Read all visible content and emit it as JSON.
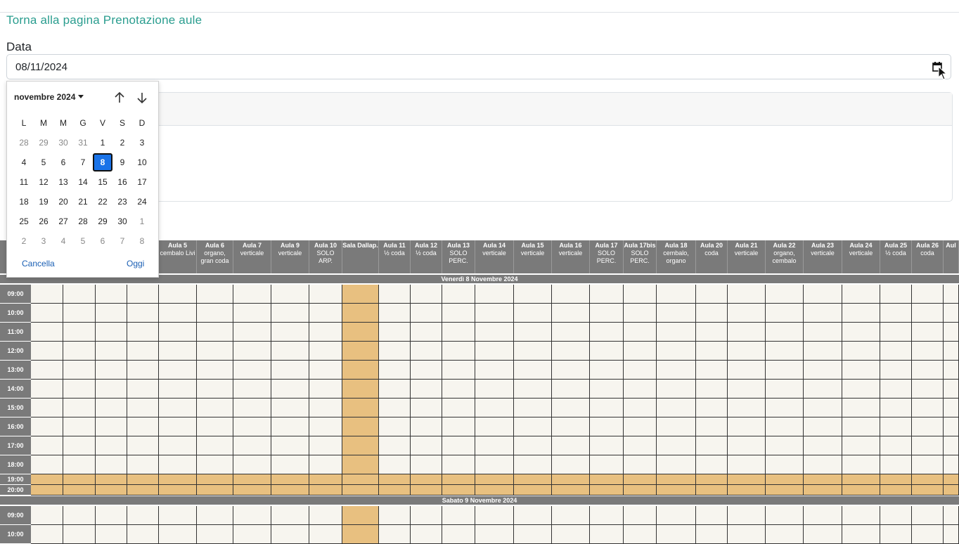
{
  "page": {
    "back_link": "Torna alla pagina Prenotazione aule",
    "date_label": "Data",
    "date_value": "08/11/2024"
  },
  "picker": {
    "month_label": "novembre 2024",
    "weekdays": [
      "L",
      "M",
      "M",
      "G",
      "V",
      "S",
      "D"
    ],
    "weeks": [
      [
        "28",
        "29",
        "30",
        "31",
        "1",
        "2",
        "3"
      ],
      [
        "4",
        "5",
        "6",
        "7",
        "8",
        "9",
        "10"
      ],
      [
        "11",
        "12",
        "13",
        "14",
        "15",
        "16",
        "17"
      ],
      [
        "18",
        "19",
        "20",
        "21",
        "22",
        "23",
        "24"
      ],
      [
        "25",
        "26",
        "27",
        "28",
        "29",
        "30",
        "1"
      ],
      [
        "2",
        "3",
        "4",
        "5",
        "6",
        "7",
        "8"
      ]
    ],
    "selected_day": "8",
    "cancel_label": "Cancella",
    "today_label": "Oggi"
  },
  "rooms": [
    {
      "name": "Aula 5",
      "desc": "cembalo Livi"
    },
    {
      "name": "Aula 6",
      "desc": "organo, gran coda"
    },
    {
      "name": "Aula 7",
      "desc": "verticale"
    },
    {
      "name": "Aula 9",
      "desc": "verticale"
    },
    {
      "name": "Aula 10",
      "desc": "SOLO ARP."
    },
    {
      "name": "Sala Dallap.",
      "desc": ""
    },
    {
      "name": "Aula 11",
      "desc": "½ coda"
    },
    {
      "name": "Aula 12",
      "desc": "½ coda"
    },
    {
      "name": "Aula 13",
      "desc": "SOLO PERC."
    },
    {
      "name": "Aula 14",
      "desc": "verticale"
    },
    {
      "name": "Aula 15",
      "desc": "verticale"
    },
    {
      "name": "Aula 16",
      "desc": "verticale"
    },
    {
      "name": "Aula 17",
      "desc": "SOLO PERC."
    },
    {
      "name": "Aula 17bis",
      "desc": "SOLO PERC."
    },
    {
      "name": "Aula 18",
      "desc": "cembalo, organo"
    },
    {
      "name": "Aula 20",
      "desc": "coda"
    },
    {
      "name": "Aula 21",
      "desc": "verticale"
    },
    {
      "name": "Aula 22",
      "desc": "organo, cembalo"
    },
    {
      "name": "Aula 23",
      "desc": "verticale"
    },
    {
      "name": "Aula 24",
      "desc": "verticale"
    },
    {
      "name": "Aula 25",
      "desc": "½ coda"
    },
    {
      "name": "Aula 26",
      "desc": "coda"
    },
    {
      "name": "Aul",
      "desc": ""
    }
  ],
  "days": [
    {
      "label": "Venerdì 8 Novembre 2024",
      "times": [
        "09:00",
        "10:00",
        "11:00",
        "12:00",
        "13:00",
        "14:00",
        "15:00",
        "16:00",
        "17:00",
        "18:00",
        "19:00",
        "20:00"
      ]
    },
    {
      "label": "Sabato 9 Novembre 2024",
      "times": [
        "09:00",
        "10:00"
      ]
    }
  ],
  "colors": {
    "header": "#7a7a7a",
    "free": "#f7f5ef",
    "busy": "#e8c080",
    "accent": "#2a9d8f",
    "selected": "#1a73e8"
  }
}
